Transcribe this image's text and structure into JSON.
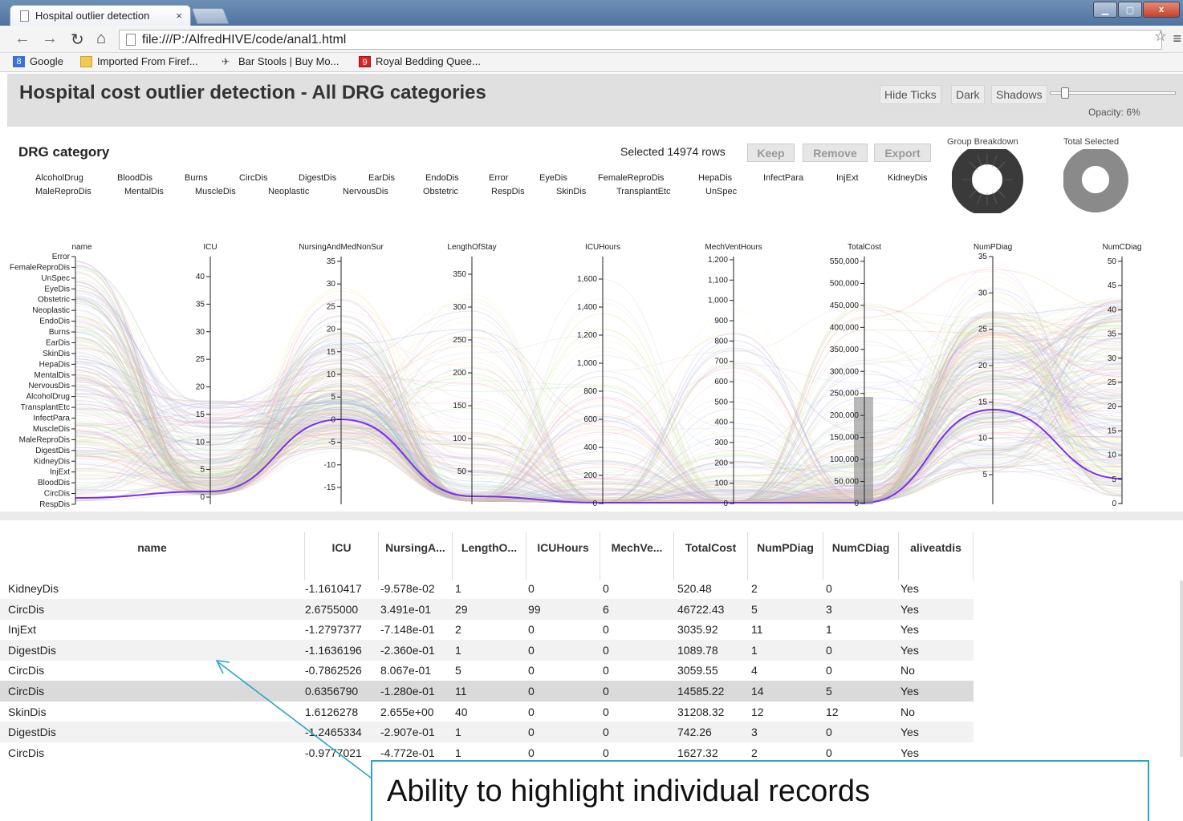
{
  "browser": {
    "tab_title": "Hospital outlier detection",
    "tab_close": "×",
    "url": "file:///P:/AlfredHIVE/code/anal1.html",
    "bookmarks": [
      "Google",
      "Imported From Firef...",
      "Bar Stools | Buy Mo...",
      "Royal Bedding Quee..."
    ]
  },
  "header": {
    "title": "Hospital cost outlier detection - All DRG categories",
    "buttons": [
      "Hide Ticks",
      "Dark",
      "Shadows"
    ],
    "opacity_label": "Opacity: 6%",
    "opacity": 0.06
  },
  "panel": {
    "title": "DRG category",
    "selected": "Selected 14974 rows",
    "actions": [
      "Keep",
      "Remove",
      "Export"
    ],
    "group_breakdown": "Group Breakdown",
    "total_selected": "Total Selected",
    "categories_row1": [
      "AlcoholDrug",
      "BloodDis",
      "Burns",
      "CircDis",
      "DigestDis",
      "EarDis",
      "EndoDis",
      "Error",
      "EyeDis",
      "FemaleReproDis",
      "HepaDis",
      "InfectPara",
      "InjExt",
      "KidneyDis"
    ],
    "categories_row2": [
      "MaleReproDis",
      "MentalDis",
      "MuscleDis",
      "Neoplastic",
      "NervousDis",
      "Obstetric",
      "RespDis",
      "SkinDis",
      "TransplantEtc",
      "UnSpec"
    ]
  },
  "parcoords": {
    "name_axis": {
      "title": "name",
      "ticks": [
        "Error",
        "FemaleReproDis",
        "UnSpec",
        "EyeDis",
        "Obstetric",
        "Neoplastic",
        "EndoDis",
        "Burns",
        "EarDis",
        "SkinDis",
        "HepaDis",
        "MentalDis",
        "NervousDis",
        "AlcoholDrug",
        "TransplantEtc",
        "InfectPara",
        "MuscleDis",
        "MaleReproDis",
        "DigestDis",
        "KidneyDis",
        "InjExt",
        "BloodDis",
        "CircDis",
        "RespDis"
      ]
    },
    "axes": [
      {
        "title": "ICU",
        "ticks": [
          "0",
          "5",
          "10",
          "15",
          "20",
          "25",
          "30",
          "35",
          "40"
        ]
      },
      {
        "title": "NursingAndMedNonSur",
        "ticks": [
          "-15",
          "-10",
          "-5",
          "0",
          "5",
          "10",
          "15",
          "20",
          "25",
          "30",
          "35"
        ]
      },
      {
        "title": "LengthOfStay",
        "ticks": [
          "50",
          "100",
          "150",
          "200",
          "250",
          "300",
          "350"
        ]
      },
      {
        "title": "ICUHours",
        "ticks": [
          "0",
          "200",
          "400",
          "600",
          "800",
          "1,000",
          "1,200",
          "1,400",
          "1,600"
        ]
      },
      {
        "title": "MechVentHours",
        "ticks": [
          "0",
          "100",
          "200",
          "300",
          "400",
          "500",
          "600",
          "700",
          "800",
          "900",
          "1,000",
          "1,100",
          "1,200"
        ]
      },
      {
        "title": "TotalCost",
        "ticks": [
          "0",
          "50,000",
          "100,000",
          "150,000",
          "200,000",
          "250,000",
          "300,000",
          "350,000",
          "400,000",
          "450,000",
          "500,000",
          "550,000"
        ]
      },
      {
        "title": "NumPDiag",
        "ticks": [
          "5",
          "10",
          "15",
          "20",
          "25",
          "30",
          "35"
        ]
      },
      {
        "title": "NumCDiag",
        "ticks": [
          "0",
          "5",
          "10",
          "15",
          "20",
          "25",
          "30",
          "35",
          "40",
          "45",
          "50"
        ]
      }
    ],
    "colors": [
      "#e8f08a",
      "#c5b4f0",
      "#9ab0f5",
      "#b8b8b8",
      "#f59ad0",
      "#a6e89a",
      "#f0c090",
      "#bbbbbb"
    ],
    "highlight_color": "#7b2ff0"
  },
  "table": {
    "headers": [
      "name",
      "ICU",
      "NursingA...",
      "LengthO...",
      "ICUHours",
      "MechVe...",
      "TotalCost",
      "NumPDiag",
      "NumCDiag",
      "aliveatdis"
    ],
    "rows": [
      [
        "KidneyDis",
        "-1.1610417",
        "-9.578e-02",
        "1",
        "0",
        "0",
        "520.48",
        "2",
        "0",
        "Yes"
      ],
      [
        "CircDis",
        "2.6755000",
        "3.491e-01",
        "29",
        "99",
        "6",
        "46722.43",
        "5",
        "3",
        "Yes"
      ],
      [
        "InjExt",
        "-1.2797377",
        "-7.148e-01",
        "2",
        "0",
        "0",
        "3035.92",
        "11",
        "1",
        "Yes"
      ],
      [
        "DigestDis",
        "-1.1636196",
        "-2.360e-01",
        "1",
        "0",
        "0",
        "1089.78",
        "1",
        "0",
        "Yes"
      ],
      [
        "CircDis",
        "-0.7862526",
        "8.067e-01",
        "5",
        "0",
        "0",
        "3059.55",
        "4",
        "0",
        "No"
      ],
      [
        "CircDis",
        "0.6356790",
        "-1.280e-01",
        "11",
        "0",
        "0",
        "14585.22",
        "14",
        "5",
        "Yes"
      ],
      [
        "SkinDis",
        "1.6126278",
        "2.655e+00",
        "40",
        "0",
        "0",
        "31208.32",
        "12",
        "12",
        "No"
      ],
      [
        "DigestDis",
        "-1.2465334",
        "-2.907e-01",
        "1",
        "0",
        "0",
        "742.26",
        "3",
        "0",
        "Yes"
      ],
      [
        "CircDis",
        "-0.9777021",
        "-4.772e-01",
        "1",
        "0",
        "0",
        "1627.32",
        "2",
        "0",
        "Yes"
      ]
    ],
    "highlighted_row": 5
  },
  "callout": {
    "text": "Ability to highlight individual records"
  }
}
